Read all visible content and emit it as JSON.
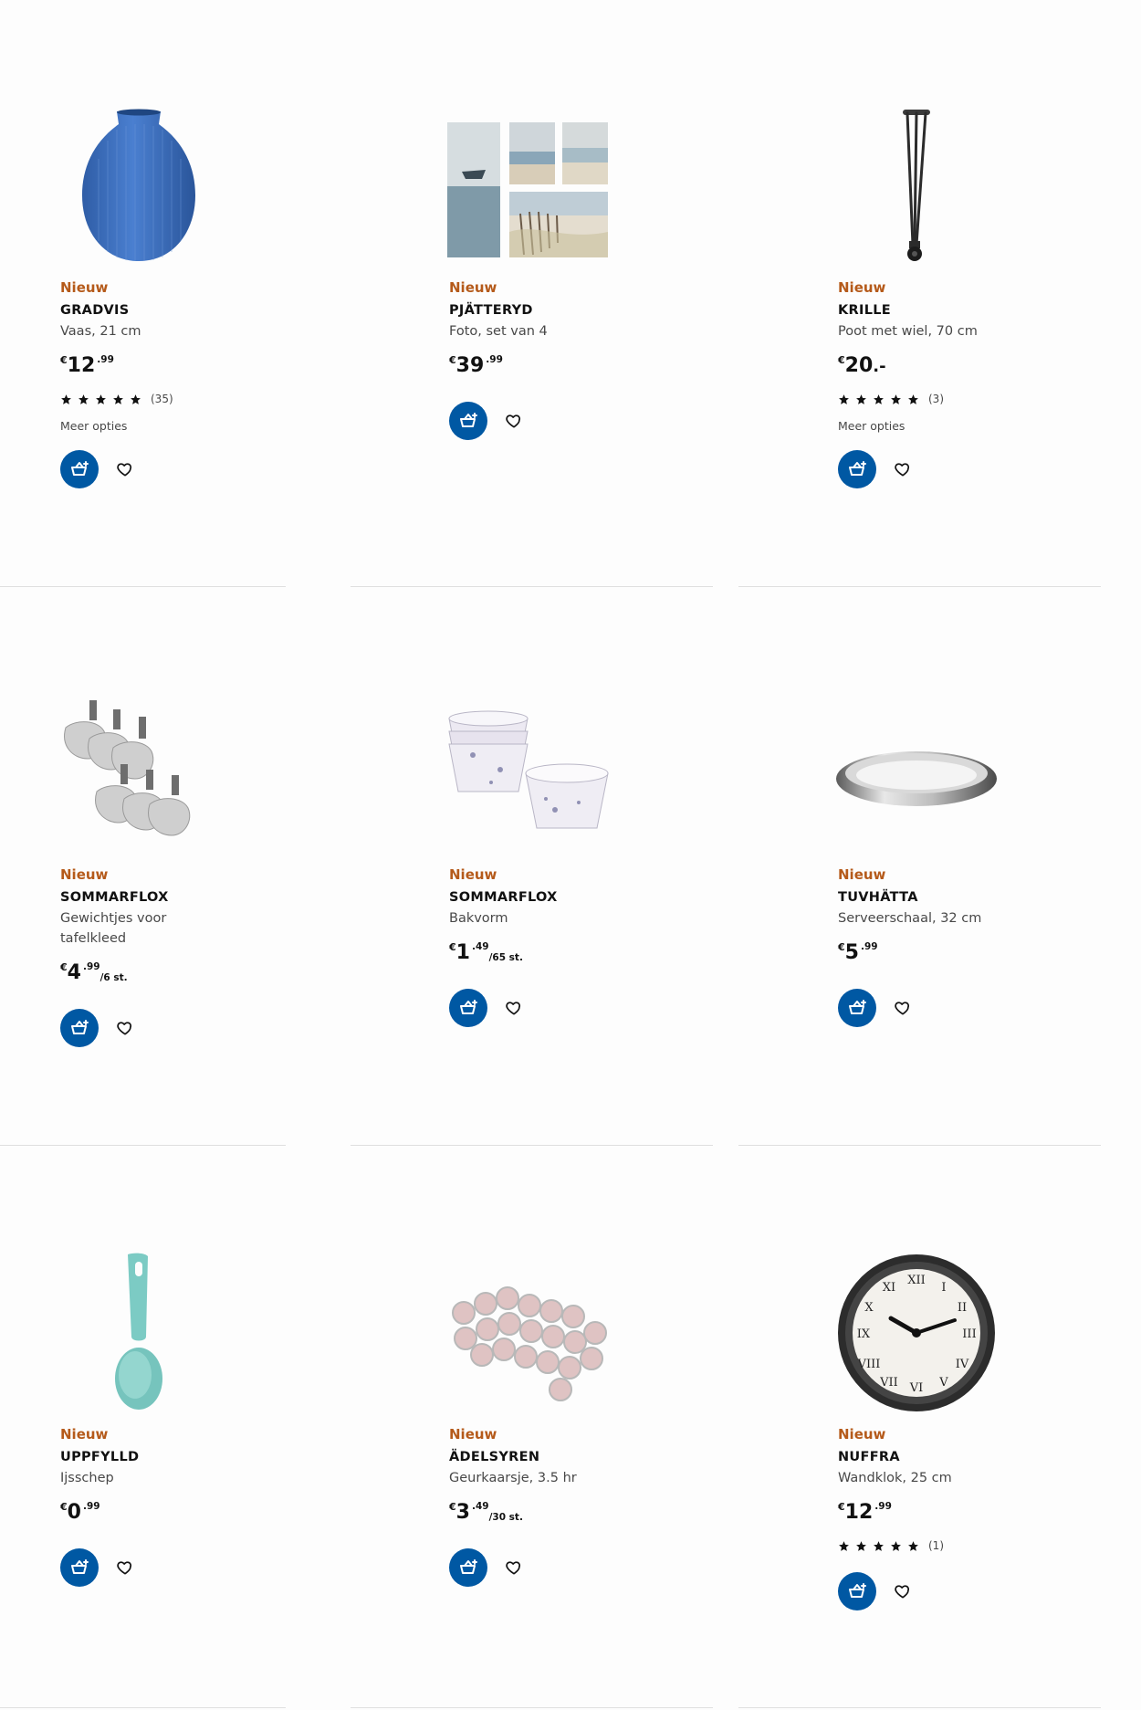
{
  "colors": {
    "badge": "#b55a1a",
    "cart_button": "#0058a3",
    "divider": "#dfdfdf"
  },
  "products": [
    {
      "badge": "Nieuw",
      "name": "GRADVIS",
      "desc": "Vaas, 21 cm",
      "currency": "€",
      "price_int": "12",
      "price_dec": ".99",
      "price_unit": "",
      "rating": 5,
      "rating_count": "(35)",
      "more": "Meer opties",
      "icon": "vase-image"
    },
    {
      "badge": "Nieuw",
      "name": "PJÄTTERYD",
      "desc": "Foto, set van 4",
      "currency": "€",
      "price_int": "39",
      "price_dec": ".99",
      "price_unit": "",
      "icon": "photo-set-image"
    },
    {
      "badge": "Nieuw",
      "name": "KRILLE",
      "desc": "Poot met wiel, 70 cm",
      "currency": "€",
      "price_int": "20",
      "price_dec": ".-",
      "price_unit": "",
      "rating": 5,
      "rating_count": "(3)",
      "more": "Meer opties",
      "icon": "table-leg-image"
    },
    {
      "badge": "Nieuw",
      "name": "SOMMARFLOX",
      "desc": "Gewichtjes voor tafelkleed",
      "currency": "€",
      "price_int": "4",
      "price_dec": ".99",
      "price_unit": "/6 st.",
      "icon": "tablecloth-weights-image"
    },
    {
      "badge": "Nieuw",
      "name": "SOMMARFLOX",
      "desc": "Bakvorm",
      "currency": "€",
      "price_int": "1",
      "price_dec": ".49",
      "price_unit": "/65 st.",
      "icon": "baking-cups-image"
    },
    {
      "badge": "Nieuw",
      "name": "TUVHÄTTA",
      "desc": "Serveerschaal, 32 cm",
      "currency": "€",
      "price_int": "5",
      "price_dec": ".99",
      "price_unit": "",
      "icon": "serving-dish-image"
    },
    {
      "badge": "Nieuw",
      "name": "UPPFYLLD",
      "desc": "Ijsschep",
      "currency": "€",
      "price_int": "0",
      "price_dec": ".99",
      "price_unit": "",
      "icon": "ice-cream-scoop-image"
    },
    {
      "badge": "Nieuw",
      "name": "ÄDELSYREN",
      "desc": "Geurkaarsje, 3.5 hr",
      "currency": "€",
      "price_int": "3",
      "price_dec": ".49",
      "price_unit": "/30 st.",
      "icon": "tealight-candles-image"
    },
    {
      "badge": "Nieuw",
      "name": "NUFFRA",
      "desc": "Wandklok, 25 cm",
      "currency": "€",
      "price_int": "12",
      "price_dec": ".99",
      "price_unit": "",
      "rating": 5,
      "rating_count": "(1)",
      "icon": "wall-clock-image"
    }
  ]
}
